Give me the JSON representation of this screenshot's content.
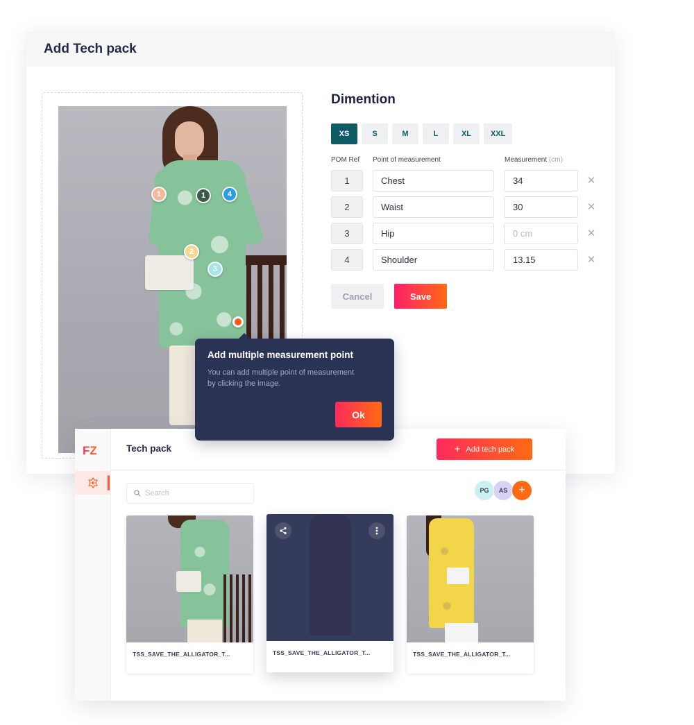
{
  "editor": {
    "title": "Add Tech pack",
    "pom_markers": [
      {
        "label": "1",
        "color": "#f5b79a"
      },
      {
        "label": "1",
        "color": "#3b5a47"
      },
      {
        "label": "4",
        "color": "#2e9be6"
      },
      {
        "label": "2",
        "color": "#f3d88f"
      },
      {
        "label": "3",
        "color": "#a6e4e6"
      }
    ],
    "dimension": {
      "title": "Dimention",
      "sizes": [
        "XS",
        "S",
        "M",
        "L",
        "XL",
        "XXL"
      ],
      "active_size": "XS",
      "columns": {
        "ref": "POM Ref",
        "point": "Point of measurement",
        "measurement": "Measurement",
        "unit": "(cm)"
      },
      "rows": [
        {
          "ref": "1",
          "point": "Chest",
          "value": "34",
          "placeholder": "0 cm"
        },
        {
          "ref": "2",
          "point": "Waist",
          "value": "30",
          "placeholder": "0 cm"
        },
        {
          "ref": "3",
          "point": "Hip",
          "value": "",
          "placeholder": "0 cm"
        },
        {
          "ref": "4",
          "point": "Shoulder",
          "value": "13.15",
          "placeholder": "0 cm"
        }
      ],
      "remove_glyph": "✕",
      "cancel_label": "Cancel",
      "save_label": "Save"
    }
  },
  "tooltip": {
    "title": "Add multiple measurement point",
    "body": "You can add multiple point of measurement by clicking the image.",
    "ok_label": "Ok"
  },
  "list": {
    "logo": "FZ",
    "title": "Tech pack",
    "add_label": "Add tech pack",
    "add_glyph": "+",
    "search_placeholder": "Search",
    "avatars": [
      "PG",
      "AS"
    ],
    "avatar_add": "+",
    "cards": [
      {
        "name": "TSS_SAVE_THE_ALLIGATOR_T..."
      },
      {
        "name": "TSS_SAVE_THE_ALLIGATOR_T..."
      },
      {
        "name": "TSS_SAVE_THE_ALLIGATOR_T..."
      }
    ]
  },
  "colors": {
    "accent_teal": "#0e5b66",
    "gradient_start": "#ff1f6a",
    "gradient_end": "#ff6a13",
    "tooltip_bg": "#2b3354"
  }
}
